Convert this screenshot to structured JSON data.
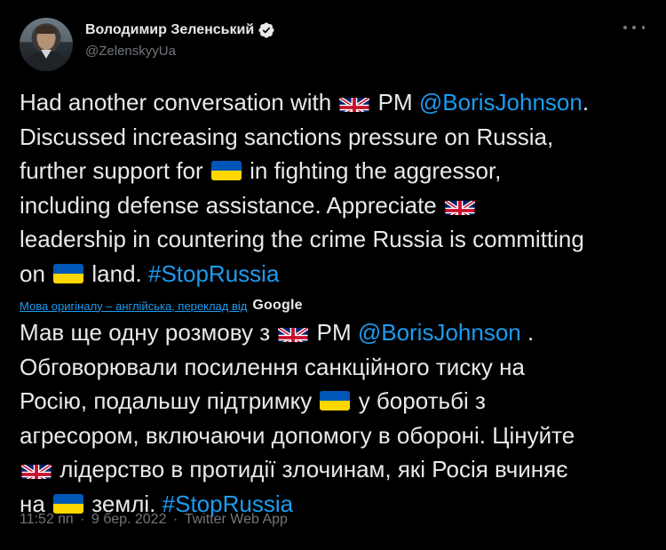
{
  "author": {
    "display_name": "Володимир Зеленський",
    "handle": "@ZelenskyyUa"
  },
  "tweet": {
    "en_lines": [
      [
        {
          "t": "text",
          "v": "Had another conversation with "
        },
        {
          "t": "flag",
          "v": "uk"
        },
        {
          "t": "text",
          "v": " PM "
        },
        {
          "t": "link",
          "v": "@BorisJohnson"
        },
        {
          "t": "text",
          "v": "."
        }
      ],
      [
        {
          "t": "text",
          "v": "Discussed increasing sanctions pressure on Russia,"
        }
      ],
      [
        {
          "t": "text",
          "v": "further support for "
        },
        {
          "t": "flag",
          "v": "ua"
        },
        {
          "t": "text",
          "v": " in fighting the aggressor,"
        }
      ],
      [
        {
          "t": "text",
          "v": "including defense assistance. Appreciate "
        },
        {
          "t": "flag",
          "v": "uk"
        }
      ],
      [
        {
          "t": "text",
          "v": "leadership in countering the crime Russia is committing"
        }
      ],
      [
        {
          "t": "text",
          "v": "on "
        },
        {
          "t": "flag",
          "v": "ua"
        },
        {
          "t": "text",
          "v": " land. "
        },
        {
          "t": "link",
          "v": "#StopRussia"
        }
      ]
    ],
    "translation_note": "Мова оригіналу – англійська, переклад від",
    "translation_provider": "Google",
    "uk_lines": [
      [
        {
          "t": "text",
          "v": "Мав ще одну розмову з "
        },
        {
          "t": "flag",
          "v": "uk"
        },
        {
          "t": "text",
          "v": " PM "
        },
        {
          "t": "link",
          "v": "@BorisJohnson"
        },
        {
          "t": "text",
          "v": " ."
        }
      ],
      [
        {
          "t": "text",
          "v": "Обговорювали посилення санкційного тиску на"
        }
      ],
      [
        {
          "t": "text",
          "v": "Росію, подальшу підтримку "
        },
        {
          "t": "flag",
          "v": "ua"
        },
        {
          "t": "text",
          "v": " у боротьбі з"
        }
      ],
      [
        {
          "t": "text",
          "v": "агресором, включаючи допомогу в обороні. Цінуйте"
        }
      ],
      [
        {
          "t": "flag",
          "v": "uk"
        },
        {
          "t": "text",
          "v": " лідерство в протидії злочинам, які Росія вчиняє"
        }
      ],
      [
        {
          "t": "text",
          "v": "на "
        },
        {
          "t": "flag",
          "v": "ua"
        },
        {
          "t": "text",
          "v": " землі. "
        },
        {
          "t": "link",
          "v": "#StopRussia"
        }
      ]
    ]
  },
  "meta": {
    "time": "11:52 пп",
    "date": "9 бер. 2022",
    "source": "Twitter Web App",
    "separator": "·"
  },
  "colors": {
    "background": "#000000",
    "text": "#e7e9ea",
    "muted": "#71767b",
    "link": "#1d9bf0"
  },
  "icons": {
    "verified": "verified-badge-icon",
    "more": "more-options-icon"
  }
}
